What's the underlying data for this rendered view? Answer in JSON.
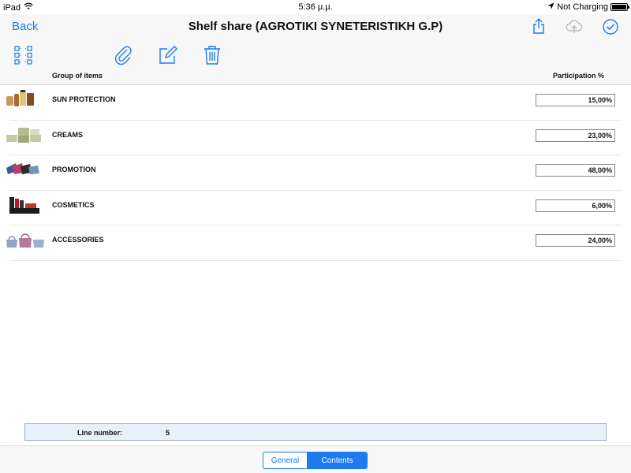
{
  "status": {
    "device": "iPad",
    "time": "5:36 μ.μ.",
    "charging": "Not Charging"
  },
  "nav": {
    "back": "Back",
    "title": "Shelf share (AGROTIKI SYNETERISTIKH G.P)"
  },
  "header": {
    "group": "Group of items",
    "participation": "Participation %"
  },
  "rows": [
    {
      "name": "SUN PROTECTION",
      "pct": "15,00%"
    },
    {
      "name": "CREAMS",
      "pct": "23,00%"
    },
    {
      "name": "PROMOTION",
      "pct": "48,00%"
    },
    {
      "name": "COSMETICS",
      "pct": "6,00%"
    },
    {
      "name": "ACCESSORIES",
      "pct": "24,00%"
    }
  ],
  "summary": {
    "label": "Line number:",
    "value": "5"
  },
  "segments": {
    "general": "General",
    "contents": "Contents"
  },
  "colors": {
    "accent": "#1a7cf0",
    "bar": "#f7f7f7"
  }
}
